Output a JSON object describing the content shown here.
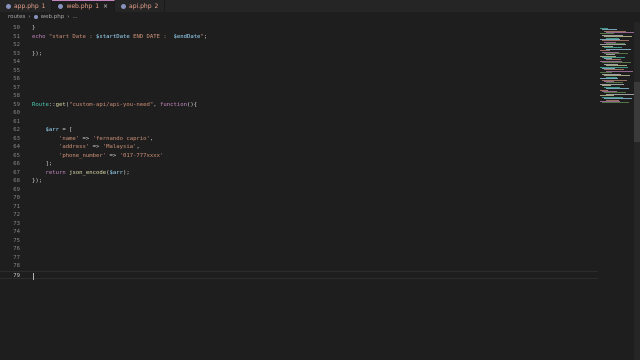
{
  "tabs": [
    {
      "label": "app.php",
      "count": "1",
      "active": false
    },
    {
      "label": "web.php",
      "count": "1",
      "active": true,
      "close": "×"
    },
    {
      "label": "api.php",
      "count": "2",
      "active": false
    }
  ],
  "breadcrumb": {
    "folder": "routes",
    "sep1": "›",
    "file": "web.php",
    "sep2": "›",
    "symbol": "..."
  },
  "editor": {
    "current_line": "79",
    "lines": [
      {
        "n": "50",
        "code": "}"
      },
      {
        "n": "51",
        "code": "echo \"start Date : $startDate END DATE :  $endDate\";"
      },
      {
        "n": "52",
        "code": ""
      },
      {
        "n": "53",
        "code": "});"
      },
      {
        "n": "54",
        "code": ""
      },
      {
        "n": "55",
        "code": ""
      },
      {
        "n": "56",
        "code": ""
      },
      {
        "n": "57",
        "code": ""
      },
      {
        "n": "58",
        "code": ""
      },
      {
        "n": "59",
        "code": "Route::get(\"custom-api/api-you-need\", function(){"
      },
      {
        "n": "60",
        "code": ""
      },
      {
        "n": "61",
        "code": ""
      },
      {
        "n": "62",
        "code": "    $arr = ["
      },
      {
        "n": "63",
        "code": "        'name' => 'fernando caprio',"
      },
      {
        "n": "64",
        "code": "        'address' => 'Malaysia',"
      },
      {
        "n": "65",
        "code": "        'phone_number' => '017-777xxxx'"
      },
      {
        "n": "66",
        "code": "    ];"
      },
      {
        "n": "67",
        "code": "    return json_encode($arr);"
      },
      {
        "n": "68",
        "code": "});"
      },
      {
        "n": "69",
        "code": ""
      },
      {
        "n": "70",
        "code": ""
      },
      {
        "n": "71",
        "code": ""
      },
      {
        "n": "72",
        "code": ""
      },
      {
        "n": "73",
        "code": ""
      },
      {
        "n": "74",
        "code": ""
      },
      {
        "n": "75",
        "code": ""
      },
      {
        "n": "76",
        "code": ""
      },
      {
        "n": "77",
        "code": ""
      },
      {
        "n": "78",
        "code": ""
      },
      {
        "n": "79",
        "code": ""
      }
    ]
  },
  "colors": {
    "background": "#1e1e1e",
    "keyword": "#c586c0",
    "function": "#dcdcaa",
    "class": "#4ec9b0",
    "string": "#ce9178",
    "variable": "#9cdcfe",
    "tab_warning": "#e5a08a"
  },
  "icons": {
    "php_file": "php-file-icon",
    "close": "close-icon",
    "minimap": "minimap"
  }
}
